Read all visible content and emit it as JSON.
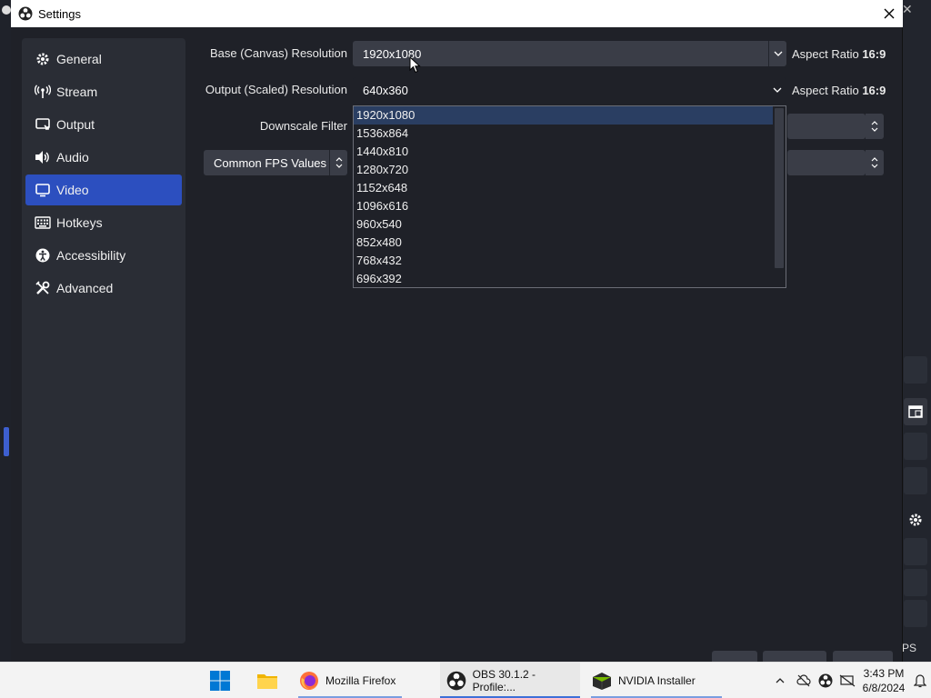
{
  "window": {
    "title": "Settings",
    "close_glyph": "✕"
  },
  "sidebar": {
    "items": [
      {
        "label": "General",
        "icon": "gear-icon"
      },
      {
        "label": "Stream",
        "icon": "broadcast-icon"
      },
      {
        "label": "Output",
        "icon": "output-icon"
      },
      {
        "label": "Audio",
        "icon": "speaker-icon"
      },
      {
        "label": "Video",
        "icon": "monitor-icon",
        "active": true
      },
      {
        "label": "Hotkeys",
        "icon": "keyboard-icon"
      },
      {
        "label": "Accessibility",
        "icon": "accessibility-icon"
      },
      {
        "label": "Advanced",
        "icon": "tools-icon"
      }
    ]
  },
  "video": {
    "base_label": "Base (Canvas) Resolution",
    "base_value": "1920x1080",
    "base_aspect_prefix": "Aspect Ratio",
    "base_aspect_value": "16:9",
    "output_label": "Output (Scaled) Resolution",
    "output_value": "640x360",
    "output_aspect_prefix": "Aspect Ratio",
    "output_aspect_value": "16:9",
    "downscale_label": "Downscale Filter",
    "fps_type_value": "Common FPS Values"
  },
  "dropdown": {
    "options": [
      "1920x1080",
      "1536x864",
      "1440x810",
      "1280x720",
      "1152x648",
      "1096x616",
      "960x540",
      "852x480",
      "768x432",
      "696x392"
    ],
    "selected_index": 0
  },
  "background": {
    "fps_text": "PS",
    "close_glyph": "✕"
  },
  "taskbar": {
    "apps": [
      {
        "label": "Mozilla Firefox",
        "icon": "firefox-icon"
      },
      {
        "label": "OBS 30.1.2 - Profile:...",
        "icon": "obs-icon",
        "active": true
      },
      {
        "label": "NVIDIA Installer",
        "icon": "nvidia-icon"
      }
    ],
    "tray_chevron": "^",
    "time": "3:43 PM",
    "date": "6/8/2024"
  },
  "colors": {
    "accent": "#2c4fbf",
    "dropdown_selected": "#2a3e62",
    "window_bg": "#1f2128",
    "panel_bg": "#2a2d35",
    "combo_bg": "#3a3d47"
  }
}
